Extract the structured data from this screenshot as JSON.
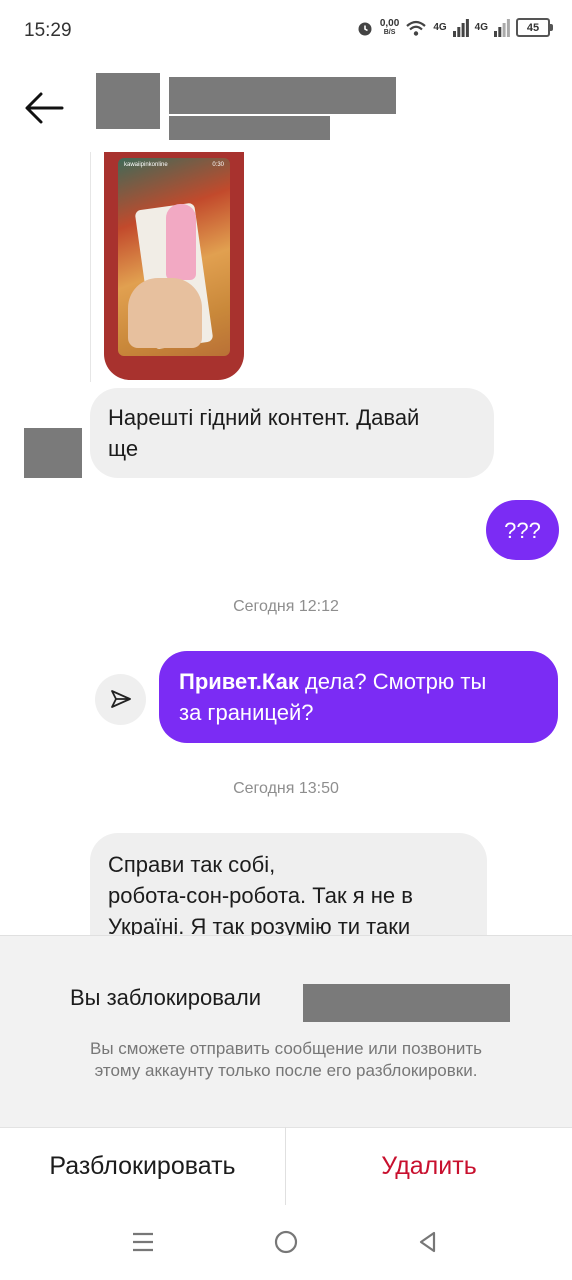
{
  "status_bar": {
    "time": "15:29",
    "net_speed_value": "0,00",
    "net_speed_unit": "B/S",
    "network_1": "4G",
    "network_2": "4G",
    "battery": "45"
  },
  "header": {
    "back_icon": "arrow-left-icon"
  },
  "shared_post": {
    "username": "kawaiipinkonline",
    "duration": "0:30"
  },
  "messages": [
    {
      "direction": "incoming",
      "text_line1": "Нарешті гідний контент. Давай",
      "text_line2": "ще"
    },
    {
      "direction": "outgoing",
      "text": "???"
    },
    {
      "timestamp": "Сегодня 12:12"
    },
    {
      "direction": "outgoing",
      "bold": "Привет.Как",
      "text_line1": " дела? Смотрю ты",
      "text_line2": "за границей?"
    },
    {
      "timestamp": "Сегодня 13:50"
    },
    {
      "direction": "incoming",
      "text_line1": "Справи так собі,",
      "text_line2": "робота-сон-робота. Так я не в",
      "text_line3": "Україні. Я так розумію ти таки"
    }
  ],
  "blocked": {
    "title": "Вы заблокировали",
    "description_line1": "Вы сможете отправить сообщение или позвонить",
    "description_line2": "этому аккаунту только после его разблокировки."
  },
  "actions": {
    "unblock": "Разблокировать",
    "delete": "Удалить"
  },
  "colors": {
    "outgoing_bubble": "#7b2cf4",
    "incoming_bubble": "#efefef",
    "delete": "#c8102e"
  },
  "nav": {
    "icons": [
      "menu-icon",
      "home-icon",
      "back-icon"
    ]
  }
}
